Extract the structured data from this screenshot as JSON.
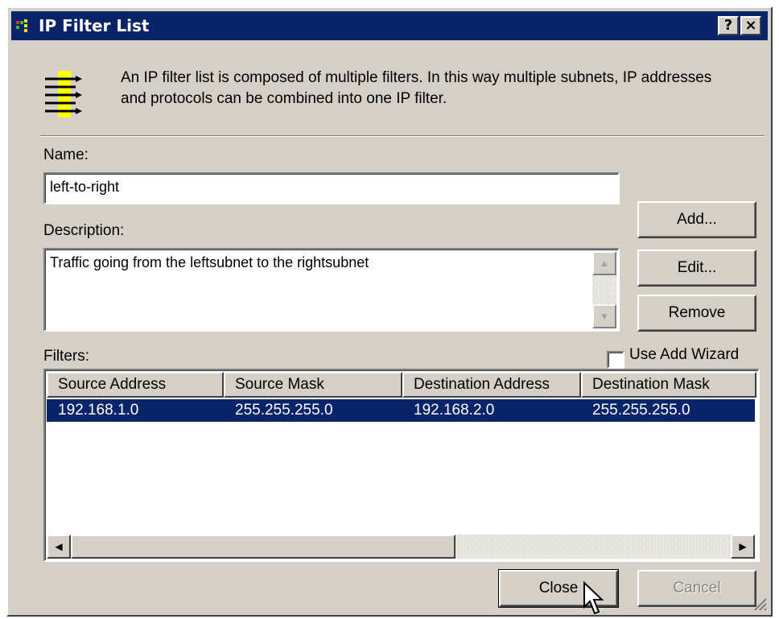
{
  "window": {
    "title": "IP Filter List",
    "help_glyph": "?",
    "close_glyph": "×"
  },
  "intro": {
    "text": "An IP filter list is composed of multiple filters. In this way multiple subnets, IP addresses and protocols can be combined into one IP filter.",
    "icon": "filter-list-icon"
  },
  "name": {
    "label": "Name:",
    "value": "left-to-right"
  },
  "description": {
    "label": "Description:",
    "value": "Traffic going from the leftsubnet to the rightsubnet"
  },
  "buttons": {
    "add": "Add...",
    "edit": "Edit...",
    "remove": "Remove",
    "close": "Close",
    "cancel": "Cancel"
  },
  "use_add_wizard": {
    "label": "Use Add Wizard",
    "checked": false
  },
  "filters": {
    "label": "Filters:",
    "columns": [
      "Source Address",
      "Source Mask",
      "Destination Address",
      "Destination Mask"
    ],
    "rows": [
      {
        "source_address": "192.168.1.0",
        "source_mask": "255.255.255.0",
        "destination_address": "192.168.2.0",
        "destination_mask": "255.255.255.0",
        "selected": true
      }
    ]
  },
  "colors": {
    "titlebar": "#0a246a",
    "dialog_face": "#d4d0c8",
    "selection": "#0a246a"
  }
}
